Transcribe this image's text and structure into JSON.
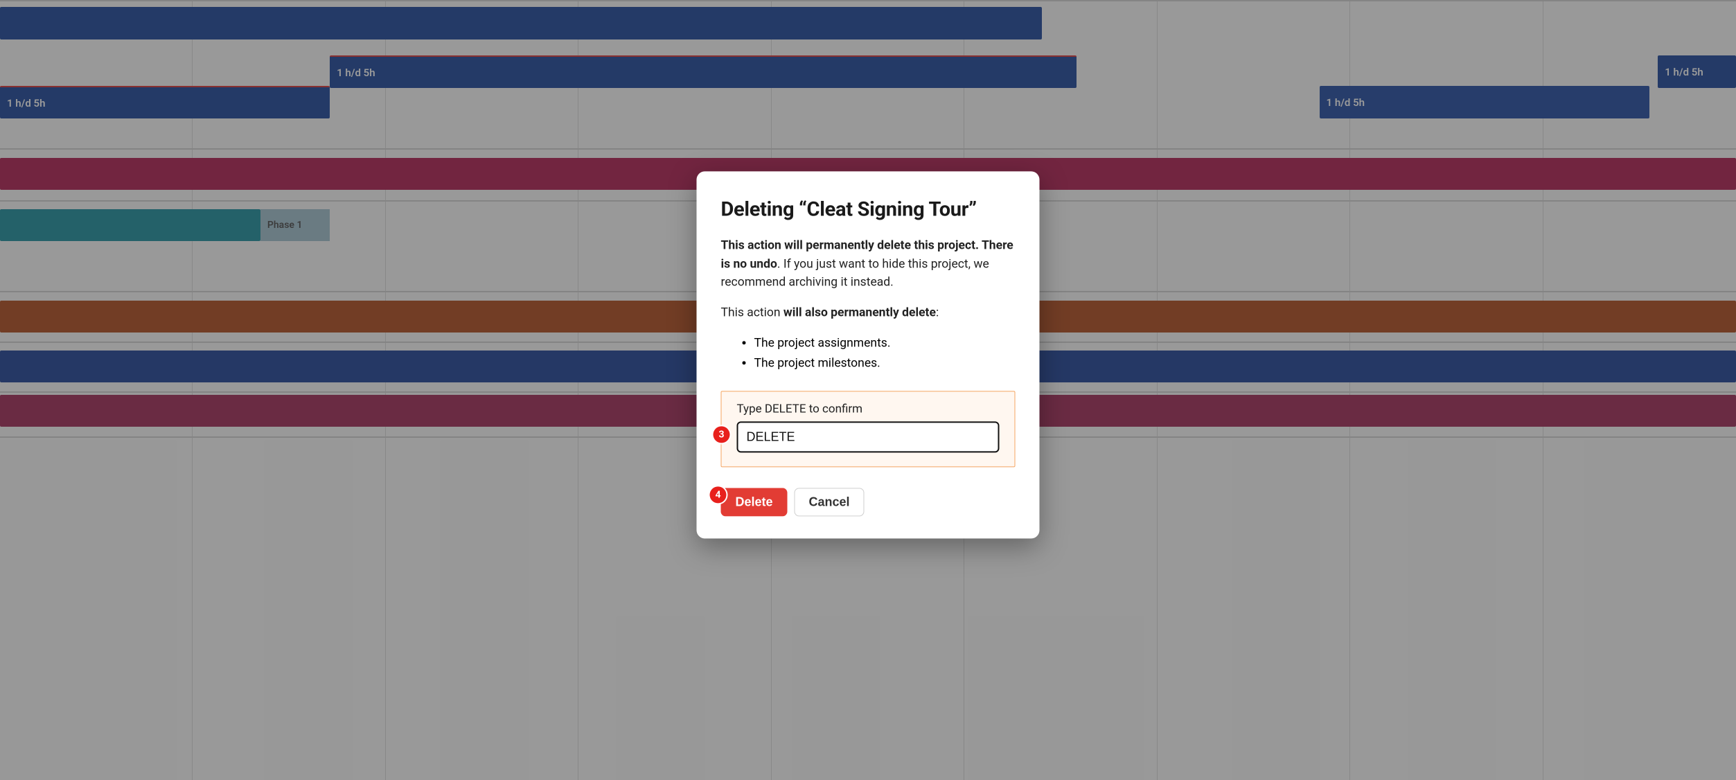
{
  "background": {
    "bars": {
      "b1_label": "1 h/d  5h",
      "b2_label": "1 h/d  5h",
      "b3_label": "1 h/d  5h",
      "b4_label": "1 h/d  5h"
    },
    "phase_label": "Phase 1"
  },
  "modal": {
    "title": "Deleting “Cleat Signing Tour”",
    "warn_strong": "This action will permanently delete this project. There is no undo",
    "warn_rest": ". If you just want to hide this project, we recommend archiving it instead.",
    "also_pre": "This action ",
    "also_strong": "will also permanently delete",
    "also_post": ":",
    "bullets": {
      "b1": "The project assignments.",
      "b2": "The project milestones."
    },
    "confirm": {
      "label": "Type DELETE to confirm",
      "value": "DELETE"
    },
    "buttons": {
      "delete": "Delete",
      "cancel": "Cancel"
    },
    "steps": {
      "s3": "3",
      "s4": "4"
    }
  }
}
